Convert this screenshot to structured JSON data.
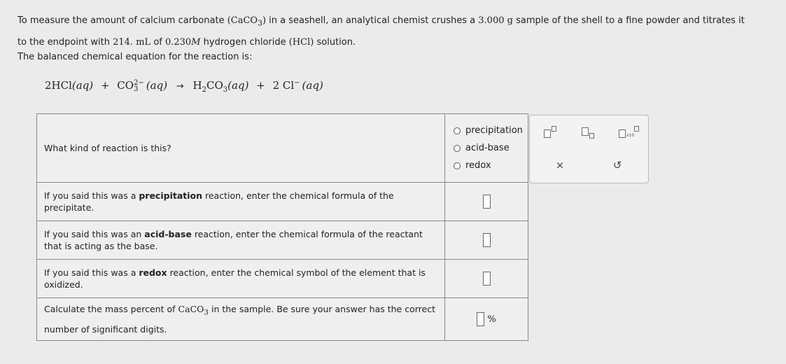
{
  "problem": {
    "line1_a": "To measure the amount of calcium carbonate ",
    "caco3_formula": "(CaCO",
    "caco3_sub": "3",
    "caco3_close": ")",
    "line1_b": " in a seashell, an analytical chemist crushes a ",
    "mass_value": "3.000 g",
    "line1_c": " sample of the shell to a fine powder and titrates it",
    "line2_a": "to the endpoint with ",
    "volume_value": "214. mL",
    "line2_b": " of ",
    "conc_value": "0.230",
    "conc_unit": "M",
    "line2_c": " hydrogen chloride ",
    "hcl_formula": "(HCl)",
    "line2_d": " solution."
  },
  "equation": {
    "intro": "The balanced chemical equation for the reaction is:",
    "r1": "2HCl",
    "r1_state": "(aq)",
    "plus1": "+",
    "r2": "CO",
    "r2_sub": "3",
    "r2_sup": "2−",
    "r2_state": "(aq)",
    "arrow": "→",
    "p1_a": "H",
    "p1_sub1": "2",
    "p1_b": "CO",
    "p1_sub2": "3",
    "p1_state": "(aq)",
    "plus2": "+",
    "p2": "2 Cl",
    "p2_sup": "−",
    "p2_state": "(aq)"
  },
  "questions": {
    "kind_prompt": "What kind of reaction is this?",
    "kind_options": [
      "precipitation",
      "acid-base",
      "redox"
    ],
    "q2_pre": "If you said this was a ",
    "q2_bold": "precipitation",
    "q2_post": " reaction, enter the chemical formula of the precipitate.",
    "q3_pre": "If you said this was an ",
    "q3_bold": "acid-base",
    "q3_post": " reaction, enter the chemical formula of the reactant that is acting as the base.",
    "q4_pre": "If you said this was a ",
    "q4_bold": "redox",
    "q4_post": " reaction, enter the chemical symbol of the element that is oxidized.",
    "q5_pre": "Calculate the mass percent of ",
    "q5_formula": "CaCO",
    "q5_sub": "3",
    "q5_post": " in the sample. Be sure your answer has the correct number of significant digits.",
    "percent_unit": "%"
  },
  "toolbox": {
    "tools": [
      "superscript-tool",
      "subscript-tool",
      "scientific-notation-tool"
    ],
    "x10_label": "x10",
    "clear_glyph": "×",
    "undo_glyph": "↺"
  }
}
